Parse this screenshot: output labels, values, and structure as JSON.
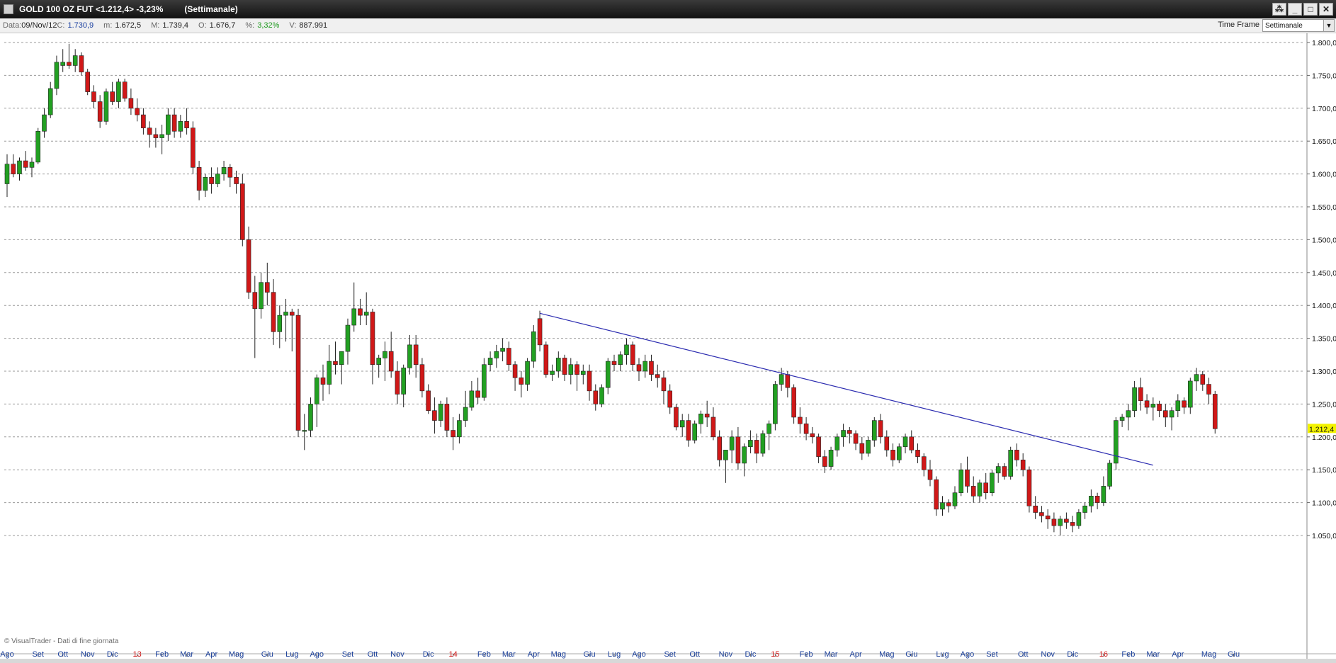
{
  "window": {
    "title_symbol": "GOLD 100 OZ FUT <1.212,4> -3,23%",
    "title_timeframe": "(Settimanale)",
    "buttons": [
      "⁂",
      "_",
      "□",
      "✕"
    ]
  },
  "infobar": {
    "date_label": "Data:",
    "date_value": "09/Nov/12",
    "close_label": "C:",
    "close_value": "1.730,9",
    "low_label": "m:",
    "low_value": "1.672,5",
    "high_label": "M:",
    "high_value": "1.739,4",
    "open_label": "O:",
    "open_value": "1.676,7",
    "pct_label": "%:",
    "pct_value": "3,32%",
    "vol_label": "V:",
    "vol_value": "887.991"
  },
  "timeframe": {
    "label": "Time Frame",
    "selected": "Settimanale"
  },
  "watermark": "© VisualTrader - Dati di fine giornata",
  "colors": {
    "bull": "#22a022",
    "bear": "#d01818",
    "trendline": "#2b2bb0",
    "last_price_bg": "#f3f300",
    "year_label": "#d01818"
  },
  "chart_data": {
    "type": "candlestick",
    "symbol": "GOLD 100 OZ FUT",
    "timeframe": "Settimanale",
    "last_price": "1.212,4",
    "ylim": [
      1040,
      1805
    ],
    "yticks": [
      1050,
      1100,
      1150,
      1200,
      1250,
      1300,
      1350,
      1400,
      1450,
      1500,
      1550,
      1600,
      1650,
      1700,
      1750,
      1800
    ],
    "ytick_labels": [
      "1.050,0",
      "1.100,0",
      "1.150,0",
      "1.200,0",
      "1.250,0",
      "1.300,0",
      "1.350,0",
      "1.400,0",
      "1.450,0",
      "1.500,0",
      "1.550,0",
      "1.600,0",
      "1.650,0",
      "1.700,0",
      "1.750,0",
      "1.800,0"
    ],
    "grid": true,
    "xticks": [
      {
        "bar": 0,
        "label": "Ago",
        "year": false
      },
      {
        "bar": 5,
        "label": "Set",
        "year": false
      },
      {
        "bar": 9,
        "label": "Ott",
        "year": false
      },
      {
        "bar": 13,
        "label": "Nov",
        "year": false
      },
      {
        "bar": 17,
        "label": "Dic",
        "year": false
      },
      {
        "bar": 21,
        "label": "13",
        "year": true
      },
      {
        "bar": 25,
        "label": "Feb",
        "year": false
      },
      {
        "bar": 29,
        "label": "Mar",
        "year": false
      },
      {
        "bar": 33,
        "label": "Apr",
        "year": false
      },
      {
        "bar": 37,
        "label": "Mag",
        "year": false
      },
      {
        "bar": 42,
        "label": "Giu",
        "year": false
      },
      {
        "bar": 46,
        "label": "Lug",
        "year": false
      },
      {
        "bar": 50,
        "label": "Ago",
        "year": false
      },
      {
        "bar": 55,
        "label": "Set",
        "year": false
      },
      {
        "bar": 59,
        "label": "Ott",
        "year": false
      },
      {
        "bar": 63,
        "label": "Nov",
        "year": false
      },
      {
        "bar": 68,
        "label": "Dic",
        "year": false
      },
      {
        "bar": 72,
        "label": "14",
        "year": true
      },
      {
        "bar": 77,
        "label": "Feb",
        "year": false
      },
      {
        "bar": 81,
        "label": "Mar",
        "year": false
      },
      {
        "bar": 85,
        "label": "Apr",
        "year": false
      },
      {
        "bar": 89,
        "label": "Mag",
        "year": false
      },
      {
        "bar": 94,
        "label": "Giu",
        "year": false
      },
      {
        "bar": 98,
        "label": "Lug",
        "year": false
      },
      {
        "bar": 102,
        "label": "Ago",
        "year": false
      },
      {
        "bar": 107,
        "label": "Set",
        "year": false
      },
      {
        "bar": 111,
        "label": "Ott",
        "year": false
      },
      {
        "bar": 116,
        "label": "Nov",
        "year": false
      },
      {
        "bar": 120,
        "label": "Dic",
        "year": false
      },
      {
        "bar": 124,
        "label": "15",
        "year": true
      },
      {
        "bar": 129,
        "label": "Feb",
        "year": false
      },
      {
        "bar": 133,
        "label": "Mar",
        "year": false
      },
      {
        "bar": 137,
        "label": "Apr",
        "year": false
      },
      {
        "bar": 142,
        "label": "Mag",
        "year": false
      },
      {
        "bar": 146,
        "label": "Giu",
        "year": false
      },
      {
        "bar": 151,
        "label": "Lug",
        "year": false
      },
      {
        "bar": 155,
        "label": "Ago",
        "year": false
      },
      {
        "bar": 159,
        "label": "Set",
        "year": false
      },
      {
        "bar": 164,
        "label": "Ott",
        "year": false
      },
      {
        "bar": 168,
        "label": "Nov",
        "year": false
      },
      {
        "bar": 172,
        "label": "Dic",
        "year": false
      },
      {
        "bar": 177,
        "label": "16",
        "year": true
      },
      {
        "bar": 181,
        "label": "Feb",
        "year": false
      },
      {
        "bar": 185,
        "label": "Mar",
        "year": false
      },
      {
        "bar": 189,
        "label": "Apr",
        "year": false
      },
      {
        "bar": 194,
        "label": "Mag",
        "year": false
      },
      {
        "bar": 198,
        "label": "Giu",
        "year": false
      }
    ],
    "trendline": [
      {
        "bar": 86,
        "price": 1388
      },
      {
        "bar": 185,
        "price": 1157
      }
    ],
    "candles": [
      [
        1585,
        1630,
        1565,
        1615
      ],
      [
        1615,
        1630,
        1595,
        1600
      ],
      [
        1600,
        1625,
        1590,
        1620
      ],
      [
        1620,
        1635,
        1605,
        1610
      ],
      [
        1610,
        1625,
        1595,
        1618
      ],
      [
        1618,
        1670,
        1615,
        1665
      ],
      [
        1665,
        1700,
        1655,
        1690
      ],
      [
        1690,
        1740,
        1685,
        1730
      ],
      [
        1730,
        1780,
        1720,
        1770
      ],
      [
        1765,
        1790,
        1755,
        1770
      ],
      [
        1770,
        1798,
        1760,
        1765
      ],
      [
        1765,
        1790,
        1755,
        1780
      ],
      [
        1780,
        1785,
        1750,
        1755
      ],
      [
        1755,
        1760,
        1720,
        1725
      ],
      [
        1725,
        1735,
        1700,
        1710
      ],
      [
        1710,
        1720,
        1670,
        1680
      ],
      [
        1680,
        1730,
        1675,
        1725
      ],
      [
        1725,
        1740,
        1705,
        1710
      ],
      [
        1710,
        1745,
        1700,
        1740
      ],
      [
        1740,
        1745,
        1710,
        1715
      ],
      [
        1715,
        1730,
        1690,
        1700
      ],
      [
        1700,
        1715,
        1680,
        1690
      ],
      [
        1690,
        1700,
        1660,
        1670
      ],
      [
        1670,
        1680,
        1640,
        1660
      ],
      [
        1660,
        1670,
        1640,
        1655
      ],
      [
        1655,
        1675,
        1630,
        1660
      ],
      [
        1660,
        1700,
        1650,
        1690
      ],
      [
        1690,
        1700,
        1655,
        1665
      ],
      [
        1665,
        1690,
        1655,
        1680
      ],
      [
        1680,
        1700,
        1660,
        1670
      ],
      [
        1670,
        1680,
        1600,
        1610
      ],
      [
        1610,
        1620,
        1560,
        1575
      ],
      [
        1575,
        1600,
        1565,
        1595
      ],
      [
        1595,
        1610,
        1570,
        1585
      ],
      [
        1585,
        1610,
        1580,
        1600
      ],
      [
        1600,
        1620,
        1590,
        1610
      ],
      [
        1610,
        1615,
        1580,
        1595
      ],
      [
        1595,
        1605,
        1570,
        1585
      ],
      [
        1585,
        1600,
        1490,
        1500
      ],
      [
        1500,
        1520,
        1410,
        1420
      ],
      [
        1420,
        1445,
        1320,
        1395
      ],
      [
        1395,
        1450,
        1380,
        1435
      ],
      [
        1435,
        1465,
        1400,
        1420
      ],
      [
        1420,
        1440,
        1340,
        1360
      ],
      [
        1360,
        1400,
        1335,
        1385
      ],
      [
        1385,
        1410,
        1345,
        1390
      ],
      [
        1390,
        1395,
        1330,
        1385
      ],
      [
        1385,
        1395,
        1200,
        1210
      ],
      [
        1210,
        1235,
        1180,
        1210
      ],
      [
        1210,
        1260,
        1200,
        1250
      ],
      [
        1250,
        1295,
        1215,
        1290
      ],
      [
        1290,
        1310,
        1255,
        1280
      ],
      [
        1280,
        1340,
        1265,
        1315
      ],
      [
        1315,
        1345,
        1295,
        1310
      ],
      [
        1310,
        1320,
        1280,
        1330
      ],
      [
        1330,
        1380,
        1310,
        1370
      ],
      [
        1370,
        1435,
        1360,
        1395
      ],
      [
        1395,
        1410,
        1370,
        1385
      ],
      [
        1385,
        1420,
        1370,
        1390
      ],
      [
        1390,
        1395,
        1280,
        1310
      ],
      [
        1310,
        1325,
        1290,
        1320
      ],
      [
        1320,
        1345,
        1285,
        1330
      ],
      [
        1330,
        1360,
        1290,
        1300
      ],
      [
        1300,
        1315,
        1250,
        1265
      ],
      [
        1265,
        1310,
        1245,
        1305
      ],
      [
        1305,
        1355,
        1295,
        1340
      ],
      [
        1340,
        1355,
        1290,
        1310
      ],
      [
        1310,
        1320,
        1260,
        1270
      ],
      [
        1270,
        1280,
        1235,
        1240
      ],
      [
        1240,
        1260,
        1205,
        1225
      ],
      [
        1225,
        1255,
        1215,
        1250
      ],
      [
        1250,
        1260,
        1200,
        1210
      ],
      [
        1210,
        1230,
        1180,
        1200
      ],
      [
        1200,
        1235,
        1190,
        1225
      ],
      [
        1225,
        1270,
        1215,
        1245
      ],
      [
        1245,
        1285,
        1240,
        1270
      ],
      [
        1270,
        1290,
        1250,
        1260
      ],
      [
        1260,
        1320,
        1255,
        1310
      ],
      [
        1310,
        1330,
        1300,
        1320
      ],
      [
        1320,
        1340,
        1305,
        1330
      ],
      [
        1330,
        1350,
        1315,
        1335
      ],
      [
        1335,
        1345,
        1300,
        1310
      ],
      [
        1310,
        1315,
        1270,
        1290
      ],
      [
        1290,
        1300,
        1260,
        1280
      ],
      [
        1280,
        1320,
        1270,
        1315
      ],
      [
        1315,
        1370,
        1305,
        1360
      ],
      [
        1380,
        1392,
        1330,
        1340
      ],
      [
        1340,
        1345,
        1290,
        1295
      ],
      [
        1295,
        1310,
        1285,
        1300
      ],
      [
        1300,
        1330,
        1290,
        1320
      ],
      [
        1320,
        1325,
        1285,
        1295
      ],
      [
        1295,
        1320,
        1280,
        1310
      ],
      [
        1310,
        1315,
        1270,
        1295
      ],
      [
        1295,
        1310,
        1280,
        1300
      ],
      [
        1300,
        1310,
        1255,
        1270
      ],
      [
        1270,
        1280,
        1240,
        1250
      ],
      [
        1250,
        1280,
        1245,
        1275
      ],
      [
        1275,
        1320,
        1265,
        1315
      ],
      [
        1315,
        1325,
        1300,
        1310
      ],
      [
        1310,
        1330,
        1300,
        1325
      ],
      [
        1325,
        1350,
        1310,
        1340
      ],
      [
        1340,
        1345,
        1300,
        1310
      ],
      [
        1310,
        1320,
        1285,
        1300
      ],
      [
        1300,
        1325,
        1290,
        1315
      ],
      [
        1315,
        1325,
        1285,
        1295
      ],
      [
        1295,
        1310,
        1275,
        1290
      ],
      [
        1290,
        1300,
        1250,
        1270
      ],
      [
        1270,
        1280,
        1235,
        1245
      ],
      [
        1245,
        1250,
        1210,
        1215
      ],
      [
        1215,
        1235,
        1200,
        1225
      ],
      [
        1225,
        1235,
        1185,
        1195
      ],
      [
        1195,
        1225,
        1190,
        1220
      ],
      [
        1220,
        1240,
        1205,
        1235
      ],
      [
        1235,
        1255,
        1215,
        1230
      ],
      [
        1230,
        1245,
        1195,
        1200
      ],
      [
        1200,
        1210,
        1155,
        1165
      ],
      [
        1165,
        1180,
        1130,
        1180
      ],
      [
        1180,
        1210,
        1160,
        1200
      ],
      [
        1200,
        1215,
        1150,
        1160
      ],
      [
        1160,
        1190,
        1140,
        1185
      ],
      [
        1185,
        1210,
        1175,
        1195
      ],
      [
        1195,
        1205,
        1160,
        1175
      ],
      [
        1175,
        1210,
        1170,
        1205
      ],
      [
        1205,
        1225,
        1180,
        1220
      ],
      [
        1220,
        1285,
        1210,
        1280
      ],
      [
        1280,
        1305,
        1270,
        1295
      ],
      [
        1295,
        1300,
        1260,
        1275
      ],
      [
        1275,
        1280,
        1220,
        1230
      ],
      [
        1230,
        1245,
        1205,
        1220
      ],
      [
        1220,
        1230,
        1195,
        1205
      ],
      [
        1205,
        1215,
        1190,
        1200
      ],
      [
        1200,
        1205,
        1160,
        1170
      ],
      [
        1170,
        1180,
        1145,
        1155
      ],
      [
        1155,
        1185,
        1150,
        1180
      ],
      [
        1180,
        1205,
        1170,
        1200
      ],
      [
        1200,
        1220,
        1185,
        1210
      ],
      [
        1210,
        1215,
        1190,
        1205
      ],
      [
        1205,
        1210,
        1180,
        1190
      ],
      [
        1190,
        1200,
        1165,
        1175
      ],
      [
        1175,
        1200,
        1170,
        1195
      ],
      [
        1195,
        1230,
        1185,
        1225
      ],
      [
        1225,
        1235,
        1190,
        1200
      ],
      [
        1200,
        1210,
        1170,
        1180
      ],
      [
        1180,
        1190,
        1155,
        1165
      ],
      [
        1165,
        1190,
        1160,
        1185
      ],
      [
        1185,
        1205,
        1175,
        1200
      ],
      [
        1200,
        1210,
        1175,
        1180
      ],
      [
        1180,
        1190,
        1160,
        1170
      ],
      [
        1170,
        1175,
        1140,
        1150
      ],
      [
        1150,
        1165,
        1125,
        1135
      ],
      [
        1135,
        1140,
        1080,
        1090
      ],
      [
        1090,
        1110,
        1080,
        1100
      ],
      [
        1100,
        1105,
        1085,
        1095
      ],
      [
        1095,
        1125,
        1090,
        1115
      ],
      [
        1115,
        1160,
        1110,
        1150
      ],
      [
        1150,
        1170,
        1115,
        1125
      ],
      [
        1125,
        1140,
        1100,
        1110
      ],
      [
        1110,
        1135,
        1100,
        1130
      ],
      [
        1130,
        1145,
        1105,
        1115
      ],
      [
        1115,
        1150,
        1110,
        1145
      ],
      [
        1145,
        1160,
        1130,
        1155
      ],
      [
        1155,
        1160,
        1135,
        1140
      ],
      [
        1140,
        1185,
        1135,
        1180
      ],
      [
        1180,
        1190,
        1155,
        1165
      ],
      [
        1165,
        1175,
        1140,
        1150
      ],
      [
        1150,
        1155,
        1085,
        1095
      ],
      [
        1095,
        1110,
        1075,
        1085
      ],
      [
        1085,
        1095,
        1070,
        1080
      ],
      [
        1080,
        1090,
        1060,
        1075
      ],
      [
        1075,
        1085,
        1055,
        1065
      ],
      [
        1065,
        1080,
        1050,
        1075
      ],
      [
        1075,
        1085,
        1060,
        1070
      ],
      [
        1070,
        1080,
        1055,
        1065
      ],
      [
        1065,
        1090,
        1060,
        1085
      ],
      [
        1085,
        1100,
        1075,
        1095
      ],
      [
        1095,
        1120,
        1085,
        1110
      ],
      [
        1110,
        1115,
        1090,
        1100
      ],
      [
        1100,
        1140,
        1095,
        1125
      ],
      [
        1125,
        1165,
        1120,
        1160
      ],
      [
        1160,
        1230,
        1150,
        1225
      ],
      [
        1225,
        1235,
        1215,
        1230
      ],
      [
        1230,
        1250,
        1210,
        1240
      ],
      [
        1240,
        1285,
        1230,
        1275
      ],
      [
        1275,
        1290,
        1240,
        1255
      ],
      [
        1255,
        1265,
        1235,
        1245
      ],
      [
        1245,
        1260,
        1225,
        1250
      ],
      [
        1250,
        1255,
        1230,
        1240
      ],
      [
        1240,
        1250,
        1215,
        1230
      ],
      [
        1230,
        1245,
        1210,
        1240
      ],
      [
        1240,
        1265,
        1230,
        1255
      ],
      [
        1255,
        1260,
        1235,
        1245
      ],
      [
        1245,
        1290,
        1235,
        1285
      ],
      [
        1285,
        1305,
        1270,
        1295
      ],
      [
        1295,
        1300,
        1270,
        1280
      ],
      [
        1280,
        1290,
        1250,
        1265
      ],
      [
        1265,
        1270,
        1205,
        1212.4
      ]
    ]
  }
}
